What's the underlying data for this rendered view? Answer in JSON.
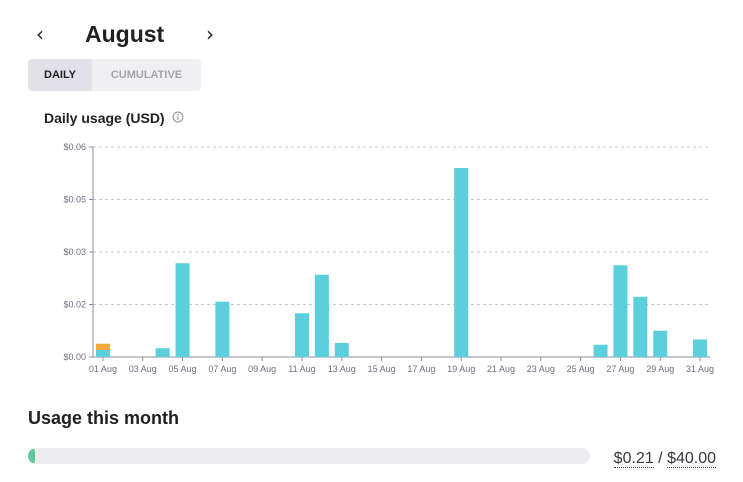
{
  "month_nav": {
    "prev_glyph": "‹",
    "next_glyph": "›",
    "month": "August"
  },
  "view_toggle": {
    "daily_label": "DAILY",
    "cumulative_label": "CUMULATIVE",
    "selected": "DAILY"
  },
  "chart_title": "Daily usage (USD)",
  "chart_data": {
    "type": "bar",
    "stacked": true,
    "ylim": [
      0,
      0.06
    ],
    "y_ticks": [
      0.0,
      0.015,
      0.03,
      0.045,
      0.06
    ],
    "y_tick_labels": [
      "$0.00",
      "$0.02",
      "$0.03",
      "$0.05",
      "$0.06"
    ],
    "x_tick_labels": [
      "01 Aug",
      "03 Aug",
      "05 Aug",
      "07 Aug",
      "09 Aug",
      "11 Aug",
      "13 Aug",
      "15 Aug",
      "17 Aug",
      "19 Aug",
      "21 Aug",
      "23 Aug",
      "25 Aug",
      "27 Aug",
      "29 Aug",
      "31 Aug"
    ],
    "grid": true,
    "categories": [
      "01 Aug",
      "02 Aug",
      "03 Aug",
      "04 Aug",
      "05 Aug",
      "06 Aug",
      "07 Aug",
      "08 Aug",
      "09 Aug",
      "10 Aug",
      "11 Aug",
      "12 Aug",
      "13 Aug",
      "14 Aug",
      "15 Aug",
      "16 Aug",
      "17 Aug",
      "18 Aug",
      "19 Aug",
      "20 Aug",
      "21 Aug",
      "22 Aug",
      "23 Aug",
      "24 Aug",
      "25 Aug",
      "26 Aug",
      "27 Aug",
      "28 Aug",
      "29 Aug",
      "30 Aug",
      "31 Aug"
    ],
    "series": [
      {
        "color": "#5bcfdc",
        "values": [
          0.002,
          0,
          0,
          0.0025,
          0.0268,
          0,
          0.0158,
          0,
          0,
          0,
          0.0125,
          0.0235,
          0.004,
          0,
          0,
          0,
          0,
          0,
          0.054,
          0,
          0,
          0,
          0,
          0,
          0,
          0.0035,
          0.0262,
          0.0172,
          0.0075,
          0,
          0.005
        ]
      },
      {
        "color": "#f2a83b",
        "values": [
          0.0018,
          0,
          0,
          0,
          0,
          0,
          0,
          0,
          0,
          0,
          0,
          0,
          0,
          0,
          0,
          0,
          0,
          0,
          0,
          0,
          0,
          0,
          0,
          0,
          0,
          0,
          0,
          0,
          0,
          0,
          0
        ]
      }
    ]
  },
  "usage": {
    "title": "Usage this month",
    "used": "$0.21",
    "separator": " / ",
    "limit": "$40.00",
    "fraction": 0.00525,
    "bar_color": "#63c7a1"
  },
  "icons": {
    "prev": "chevron-left-icon",
    "next": "chevron-right-icon",
    "info": "info-icon"
  }
}
